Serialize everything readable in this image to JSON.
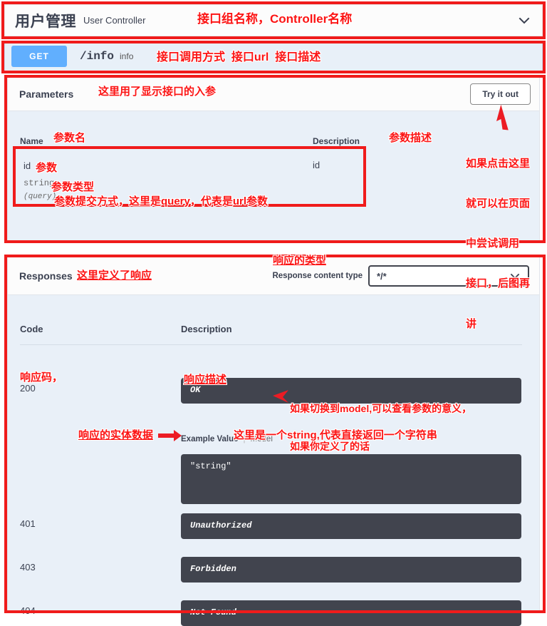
{
  "group": {
    "title": "用户管理",
    "subtitle": "User Controller",
    "chevron_icon": "chevron-down-icon"
  },
  "operation": {
    "method": "GET",
    "path": "/info",
    "summary": "info"
  },
  "parameters": {
    "title": "Parameters",
    "try_it_out_label": "Try it out",
    "columns": {
      "name": "Name",
      "description": "Description"
    },
    "rows": [
      {
        "name": "id",
        "type": "string",
        "in": "(query)",
        "description": "id"
      }
    ]
  },
  "responses": {
    "title": "Responses",
    "content_type_label": "Response content type",
    "content_type_value": "*/*",
    "content_type_chevron": "chevron-down-icon",
    "columns": {
      "code": "Code",
      "description": "Description"
    },
    "rows": [
      {
        "code": "200",
        "description": "OK",
        "example_tabs": {
          "example_value": "Example Value",
          "model": "Model"
        },
        "example_body": "\"string\""
      },
      {
        "code": "401",
        "description": "Unauthorized"
      },
      {
        "code": "403",
        "description": "Forbidden"
      },
      {
        "code": "404",
        "description": "Not Found"
      }
    ]
  },
  "annotations": {
    "group_header": "接口组名称，Controller名称",
    "operation_row": "接口调用方式  接口url  接口描述",
    "parameters_title": "这里用了显示接口的入参",
    "param_name_col": "参数名",
    "param_desc_col": "参数描述",
    "param_name": "参数",
    "param_type": "参数类型",
    "param_in": "参数提交方式，这里是query，代表是url参数",
    "try_it_out_line1": "如果点击这里",
    "try_it_out_line2": "就可以在页面",
    "try_it_out_line3": "中尝试调用",
    "try_it_out_line4": "接口，后图再",
    "try_it_out_line5": "讲",
    "responses_title": "这里定义了响应",
    "content_type": "响应的类型",
    "response_code": "响应码，",
    "response_desc": "响应描述",
    "model_tab_line1": "如果切换到model,可以查看参数的意义，",
    "model_tab_line2": "如果你定义了的话",
    "entity_data": "响应的实体数据",
    "string_note": "这里是一个string,代表直接返回一个字符串"
  },
  "colors": {
    "annotation_red": "#fc1414",
    "method_get": "#61affe",
    "code_block_bg": "#41444e",
    "body_bg": "#e9f0f8"
  }
}
